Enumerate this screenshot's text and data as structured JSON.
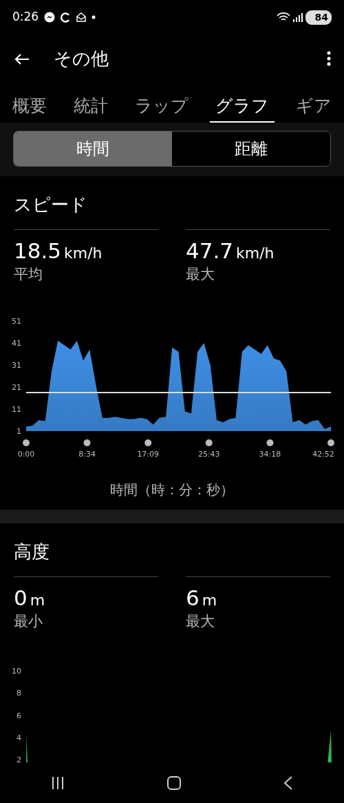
{
  "status_bar": {
    "time": "0:26",
    "battery": "84"
  },
  "app_bar": {
    "title": "その他"
  },
  "tabs": [
    {
      "label": "概要",
      "selected": false
    },
    {
      "label": "統計",
      "selected": false
    },
    {
      "label": "ラップ",
      "selected": false
    },
    {
      "label": "グラフ",
      "selected": true
    },
    {
      "label": "ギア",
      "selected": false
    }
  ],
  "segments": [
    {
      "label": "時間",
      "selected": true
    },
    {
      "label": "距離",
      "selected": false
    }
  ],
  "sections": [
    {
      "title": "スピード",
      "stats": [
        {
          "value": "18.5",
          "unit": "km/h",
          "label": "平均"
        },
        {
          "value": "47.7",
          "unit": "km/h",
          "label": "最大"
        }
      ],
      "chart_data": {
        "type": "area",
        "xlabel": "時間（時：分：秒）",
        "xlim": [
          0,
          2572
        ],
        "ylim": [
          1,
          51
        ],
        "yticks": [
          1,
          11,
          21,
          31,
          41,
          51
        ],
        "xticks": [
          {
            "value": 0,
            "label": "0:00"
          },
          {
            "value": 514,
            "label": "8:34"
          },
          {
            "value": 1029,
            "label": "17:09"
          },
          {
            "value": 1543,
            "label": "25:43"
          },
          {
            "value": 2058,
            "label": "34:18"
          },
          {
            "value": 2572,
            "label": "42:52"
          }
        ],
        "x": [
          0,
          54,
          107,
          161,
          214,
          268,
          322,
          375,
          429,
          482,
          536,
          589,
          643,
          697,
          750,
          804,
          857,
          911,
          965,
          1018,
          1072,
          1125,
          1179,
          1232,
          1286,
          1340,
          1393,
          1447,
          1500,
          1554,
          1608,
          1661,
          1715,
          1768,
          1822,
          1875,
          1929,
          1983,
          2036,
          2090,
          2143,
          2197,
          2250,
          2304,
          2358,
          2411,
          2465,
          2518,
          2572
        ],
        "series": [
          {
            "color": "#3f8fe6",
            "values": [
              3,
              3.5,
              6,
              5.5,
              28,
              42,
              40,
              38,
              42,
              33,
              38,
              22,
              7,
              7,
              7.5,
              7,
              6.5,
              6.5,
              7,
              6.5,
              4,
              7,
              7.5,
              39,
              37,
              10,
              9,
              37,
              41,
              31,
              6,
              5,
              6.5,
              7,
              37,
              40,
              38,
              36,
              40,
              34,
              33,
              28,
              5,
              6,
              4,
              5.5,
              6,
              2,
              3
            ]
          }
        ],
        "ref_lines": [
          {
            "axis": "y",
            "value": 18.5
          }
        ]
      }
    },
    {
      "title": "高度",
      "stats": [
        {
          "value": "0",
          "unit": "m",
          "label": "最小"
        },
        {
          "value": "6",
          "unit": "m",
          "label": "最大"
        }
      ],
      "axis_labels": [
        "10",
        "8",
        "6",
        "4",
        "2"
      ]
    }
  ]
}
